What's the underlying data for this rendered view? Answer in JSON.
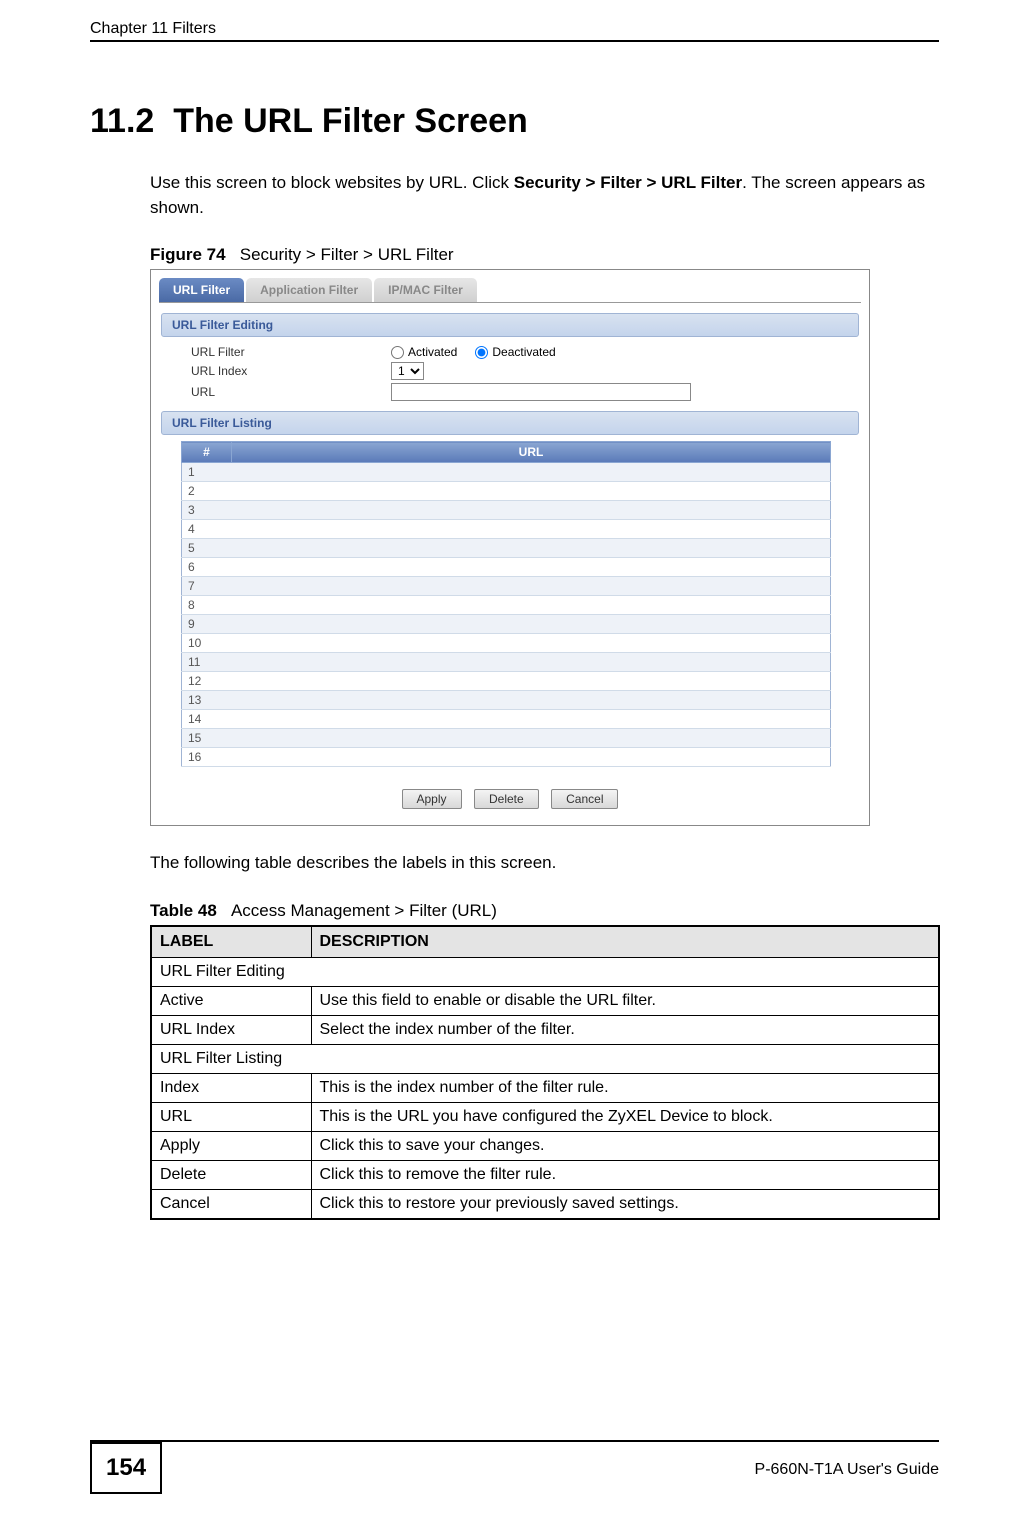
{
  "header": {
    "chapter": "Chapter 11 Filters"
  },
  "section": {
    "number": "11.2",
    "title": "The URL Filter Screen"
  },
  "intro": {
    "line1": "Use this screen to block websites by URL. Click ",
    "bold_path": "Security > Filter > URL Filter",
    "trail": ". The screen appears as shown."
  },
  "figure": {
    "label": "Figure 74",
    "caption": "Security > Filter > URL Filter"
  },
  "screenshot": {
    "tabs": {
      "url_filter": "URL Filter",
      "app_filter": "Application Filter",
      "ipmac_filter": "IP/MAC Filter"
    },
    "editing_bar": "URL Filter Editing",
    "labels": {
      "url_filter": "URL Filter",
      "url_index": "URL Index",
      "url": "URL"
    },
    "radios": {
      "activated": "Activated",
      "deactivated": "Deactivated"
    },
    "index_value": "1",
    "url_value": "",
    "listing_bar": "URL Filter Listing",
    "th_num": "#",
    "th_url": "URL",
    "rows": [
      "1",
      "2",
      "3",
      "4",
      "5",
      "6",
      "7",
      "8",
      "9",
      "10",
      "11",
      "12",
      "13",
      "14",
      "15",
      "16"
    ],
    "buttons": {
      "apply": "Apply",
      "delete": "Delete",
      "cancel": "Cancel"
    }
  },
  "post_figure_text": "The following table describes the labels in this screen.",
  "table_caption": {
    "label": "Table 48",
    "caption": "Access Management > Filter (URL)"
  },
  "doc_table": {
    "th_label": "LABEL",
    "th_desc": "DESCRIPTION",
    "rows": [
      {
        "label": "URL Filter Editing",
        "desc": "",
        "span": true
      },
      {
        "label": "Active",
        "desc": "Use this field to enable or disable the URL filter."
      },
      {
        "label": "URL Index",
        "desc": "Select the index number of the filter."
      },
      {
        "label": "URL Filter Listing",
        "desc": "",
        "span": true
      },
      {
        "label": "Index",
        "desc": "This is the index number of the filter rule."
      },
      {
        "label": "URL",
        "desc": "This is the URL you have configured the ZyXEL Device to block."
      },
      {
        "label": "Apply",
        "desc": "Click this to save your changes."
      },
      {
        "label": "Delete",
        "desc": "Click this to remove the filter rule."
      },
      {
        "label": "Cancel",
        "desc": "Click this to restore your previously saved settings."
      }
    ]
  },
  "footer": {
    "page": "154",
    "guide": "P-660N-T1A User's Guide"
  }
}
